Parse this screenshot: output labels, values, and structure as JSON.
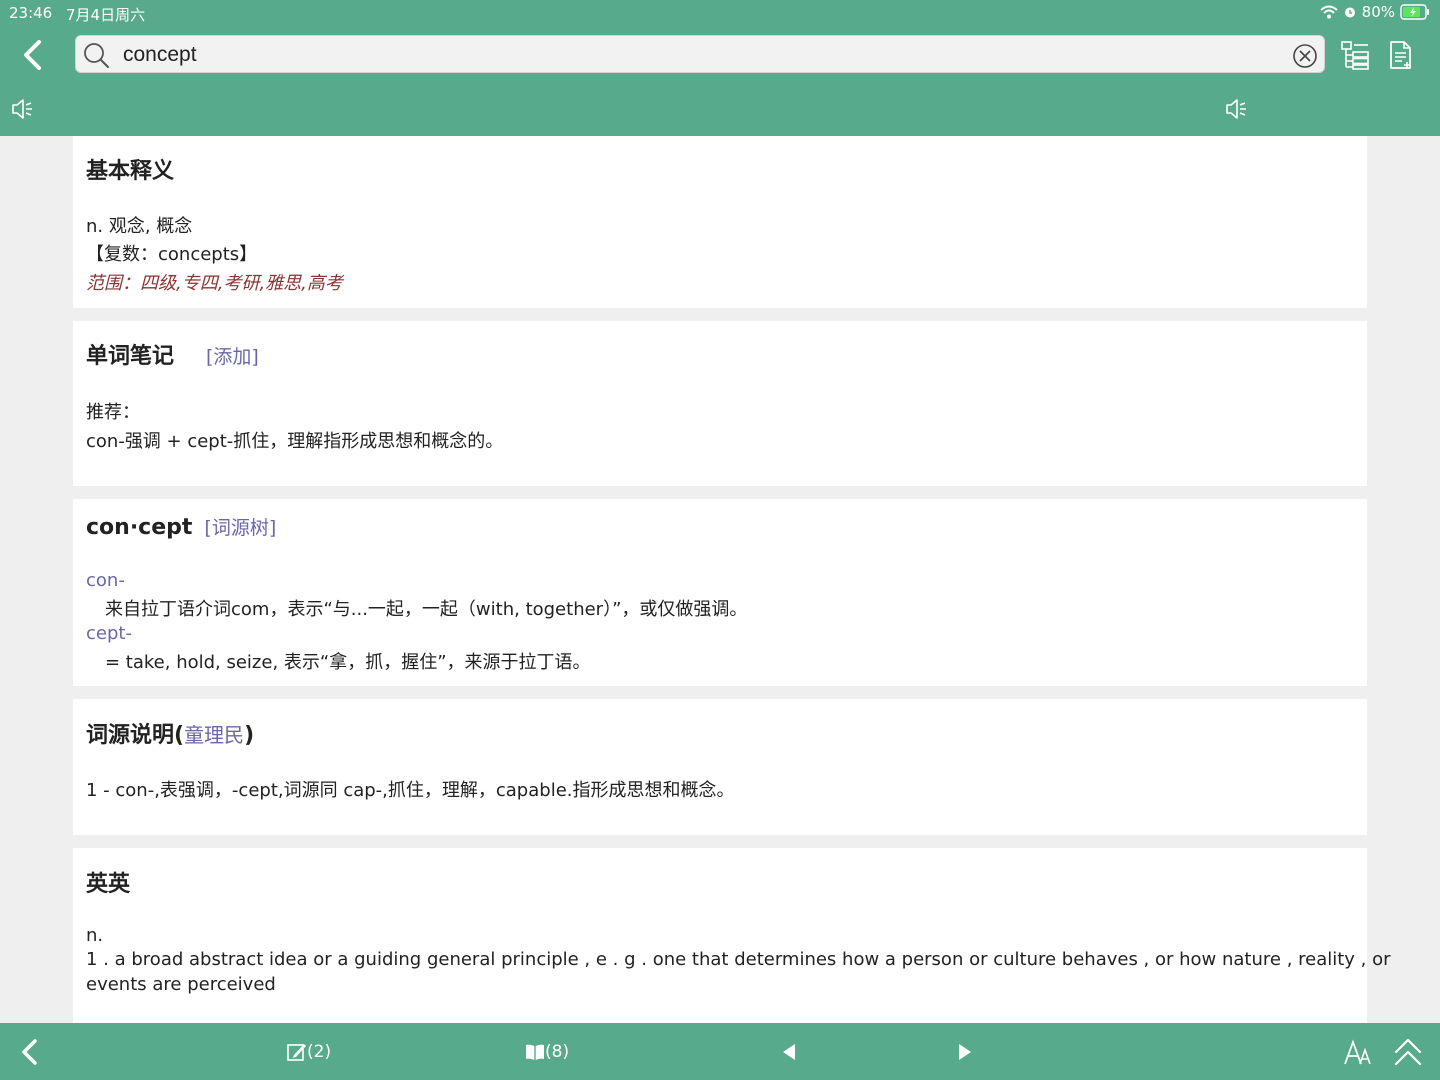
{
  "status": {
    "time": "23:46",
    "date": "7月4日周六",
    "battery": "80%"
  },
  "search": {
    "query": "concept"
  },
  "basic": {
    "title": "基本释义",
    "definition": "n. 观念, 概念",
    "plural": "【复数：concepts】",
    "scope": "范围：四级,专四,考研,雅思,高考"
  },
  "notes": {
    "title": "单词笔记",
    "add_label": "[添加]",
    "recommend_label": "推荐：",
    "recommend_text": "con-强调 + cept-抓住，理解指形成思想和概念的。"
  },
  "etymology": {
    "word": "con·cept",
    "tree_label": "[词源树]",
    "parts": [
      {
        "key": "con-",
        "desc": "来自拉丁语介词com，表示“与...一起，一起（with, together）”，或仅做强调。"
      },
      {
        "key": "cept-",
        "desc": "= take, hold, seize, 表示“拿，抓，握住”，来源于拉丁语。"
      }
    ]
  },
  "origin": {
    "title_prefix": "词源说明(",
    "author": "童理民",
    "title_suffix": ")",
    "text": "1 - con-,表强调，-cept,词源同 cap-,抓住，理解，capable.指形成思想和概念。"
  },
  "english": {
    "title": "英英",
    "pos": "n.",
    "line1": "1 . a broad abstract idea or a guiding general principle , e . g . one that determines how a person or culture behaves , or how nature , reality , or",
    "line2": "events are perceived"
  },
  "toolbar": {
    "notes_count": "(2)",
    "book_count": "(8)"
  }
}
